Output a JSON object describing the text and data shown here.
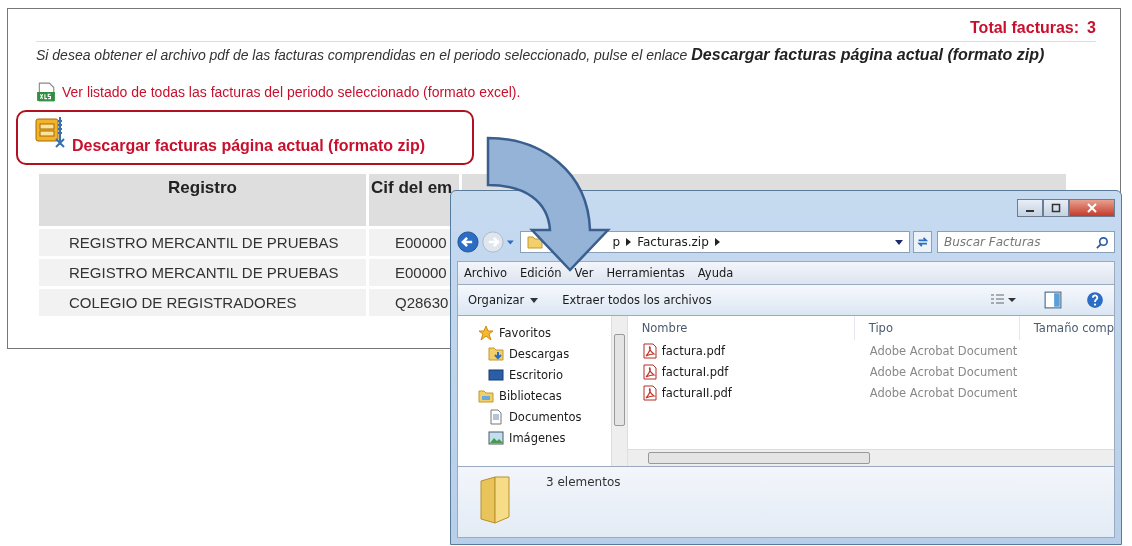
{
  "web_page": {
    "total_label": "Total facturas:",
    "total_value": "3",
    "instructions": "Si desea obtener el archivo pdf de las facturas comprendidas en el periodo seleccionado, pulse el enlace **Descargar facturas página actual (formato zip)**",
    "excel_link": "Ver listado de todas las facturas del periodo seleccionado (formato excel).",
    "zip_link": "Descargar facturas página actual (formato zip)",
    "table": {
      "columns": [
        "Registro",
        "Cif del em"
      ],
      "rows": [
        [
          "REGISTRO MERCANTIL DE PRUEBAS",
          "E00000"
        ],
        [
          "REGISTRO MERCANTIL DE PRUEBAS",
          "E00000"
        ],
        [
          "COLEGIO DE REGISTRADORES",
          "Q28630"
        ]
      ]
    }
  },
  "explorer": {
    "address": [
      "p",
      "Facturas.zip"
    ],
    "search": {
      "placeholder": "Buscar Facturas"
    },
    "menu": [
      "Archivo",
      "Edición",
      "Ver",
      "Herramientas",
      "Ayuda"
    ],
    "commands": [
      {
        "label": "Organizar",
        "dropdown": true
      },
      {
        "label": "Extraer todos los archivos",
        "dropdown": false
      }
    ],
    "nav_pane": [
      {
        "label": "Favoritos",
        "kind": "favorites",
        "children": [
          {
            "label": "Descargas",
            "kind": "downloads"
          },
          {
            "label": "Escritorio",
            "kind": "desktop"
          }
        ]
      },
      {
        "label": "Bibliotecas",
        "kind": "libraries",
        "children": [
          {
            "label": "Documentos",
            "kind": "documents"
          },
          {
            "label": "Imágenes",
            "kind": "pictures"
          }
        ]
      }
    ],
    "columns": [
      "Nombre",
      "Tipo",
      "Tamaño comp"
    ],
    "files": [
      {
        "name": "factura.pdf",
        "type": "Adobe Acrobat Document"
      },
      {
        "name": "facturaI.pdf",
        "type": "Adobe Acrobat Document"
      },
      {
        "name": "facturaII.pdf",
        "type": "Adobe Acrobat Document"
      }
    ],
    "status": "3 elementos"
  }
}
